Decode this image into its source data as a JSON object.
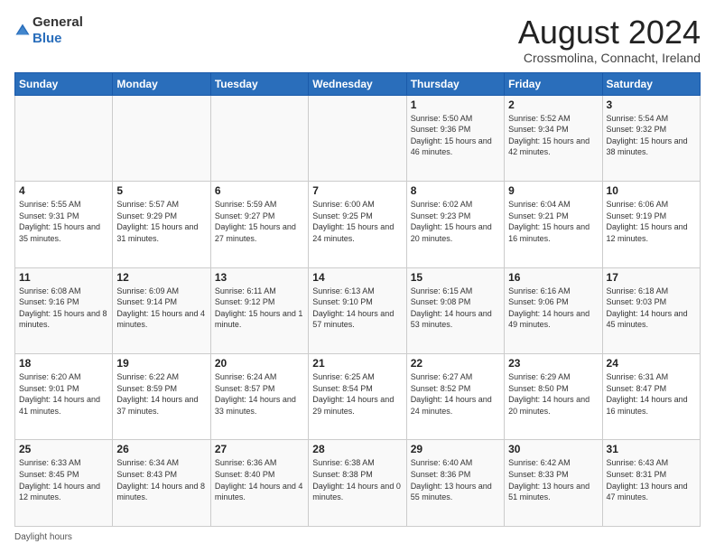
{
  "logo": {
    "general": "General",
    "blue": "Blue"
  },
  "title": "August 2024",
  "subtitle": "Crossmolina, Connacht, Ireland",
  "weekdays": [
    "Sunday",
    "Monday",
    "Tuesday",
    "Wednesday",
    "Thursday",
    "Friday",
    "Saturday"
  ],
  "footer": {
    "daylight_label": "Daylight hours"
  },
  "weeks": [
    [
      {
        "day": "",
        "sunrise": "",
        "sunset": "",
        "daylight": ""
      },
      {
        "day": "",
        "sunrise": "",
        "sunset": "",
        "daylight": ""
      },
      {
        "day": "",
        "sunrise": "",
        "sunset": "",
        "daylight": ""
      },
      {
        "day": "",
        "sunrise": "",
        "sunset": "",
        "daylight": ""
      },
      {
        "day": "1",
        "sunrise": "Sunrise: 5:50 AM",
        "sunset": "Sunset: 9:36 PM",
        "daylight": "Daylight: 15 hours and 46 minutes."
      },
      {
        "day": "2",
        "sunrise": "Sunrise: 5:52 AM",
        "sunset": "Sunset: 9:34 PM",
        "daylight": "Daylight: 15 hours and 42 minutes."
      },
      {
        "day": "3",
        "sunrise": "Sunrise: 5:54 AM",
        "sunset": "Sunset: 9:32 PM",
        "daylight": "Daylight: 15 hours and 38 minutes."
      }
    ],
    [
      {
        "day": "4",
        "sunrise": "Sunrise: 5:55 AM",
        "sunset": "Sunset: 9:31 PM",
        "daylight": "Daylight: 15 hours and 35 minutes."
      },
      {
        "day": "5",
        "sunrise": "Sunrise: 5:57 AM",
        "sunset": "Sunset: 9:29 PM",
        "daylight": "Daylight: 15 hours and 31 minutes."
      },
      {
        "day": "6",
        "sunrise": "Sunrise: 5:59 AM",
        "sunset": "Sunset: 9:27 PM",
        "daylight": "Daylight: 15 hours and 27 minutes."
      },
      {
        "day": "7",
        "sunrise": "Sunrise: 6:00 AM",
        "sunset": "Sunset: 9:25 PM",
        "daylight": "Daylight: 15 hours and 24 minutes."
      },
      {
        "day": "8",
        "sunrise": "Sunrise: 6:02 AM",
        "sunset": "Sunset: 9:23 PM",
        "daylight": "Daylight: 15 hours and 20 minutes."
      },
      {
        "day": "9",
        "sunrise": "Sunrise: 6:04 AM",
        "sunset": "Sunset: 9:21 PM",
        "daylight": "Daylight: 15 hours and 16 minutes."
      },
      {
        "day": "10",
        "sunrise": "Sunrise: 6:06 AM",
        "sunset": "Sunset: 9:19 PM",
        "daylight": "Daylight: 15 hours and 12 minutes."
      }
    ],
    [
      {
        "day": "11",
        "sunrise": "Sunrise: 6:08 AM",
        "sunset": "Sunset: 9:16 PM",
        "daylight": "Daylight: 15 hours and 8 minutes."
      },
      {
        "day": "12",
        "sunrise": "Sunrise: 6:09 AM",
        "sunset": "Sunset: 9:14 PM",
        "daylight": "Daylight: 15 hours and 4 minutes."
      },
      {
        "day": "13",
        "sunrise": "Sunrise: 6:11 AM",
        "sunset": "Sunset: 9:12 PM",
        "daylight": "Daylight: 15 hours and 1 minute."
      },
      {
        "day": "14",
        "sunrise": "Sunrise: 6:13 AM",
        "sunset": "Sunset: 9:10 PM",
        "daylight": "Daylight: 14 hours and 57 minutes."
      },
      {
        "day": "15",
        "sunrise": "Sunrise: 6:15 AM",
        "sunset": "Sunset: 9:08 PM",
        "daylight": "Daylight: 14 hours and 53 minutes."
      },
      {
        "day": "16",
        "sunrise": "Sunrise: 6:16 AM",
        "sunset": "Sunset: 9:06 PM",
        "daylight": "Daylight: 14 hours and 49 minutes."
      },
      {
        "day": "17",
        "sunrise": "Sunrise: 6:18 AM",
        "sunset": "Sunset: 9:03 PM",
        "daylight": "Daylight: 14 hours and 45 minutes."
      }
    ],
    [
      {
        "day": "18",
        "sunrise": "Sunrise: 6:20 AM",
        "sunset": "Sunset: 9:01 PM",
        "daylight": "Daylight: 14 hours and 41 minutes."
      },
      {
        "day": "19",
        "sunrise": "Sunrise: 6:22 AM",
        "sunset": "Sunset: 8:59 PM",
        "daylight": "Daylight: 14 hours and 37 minutes."
      },
      {
        "day": "20",
        "sunrise": "Sunrise: 6:24 AM",
        "sunset": "Sunset: 8:57 PM",
        "daylight": "Daylight: 14 hours and 33 minutes."
      },
      {
        "day": "21",
        "sunrise": "Sunrise: 6:25 AM",
        "sunset": "Sunset: 8:54 PM",
        "daylight": "Daylight: 14 hours and 29 minutes."
      },
      {
        "day": "22",
        "sunrise": "Sunrise: 6:27 AM",
        "sunset": "Sunset: 8:52 PM",
        "daylight": "Daylight: 14 hours and 24 minutes."
      },
      {
        "day": "23",
        "sunrise": "Sunrise: 6:29 AM",
        "sunset": "Sunset: 8:50 PM",
        "daylight": "Daylight: 14 hours and 20 minutes."
      },
      {
        "day": "24",
        "sunrise": "Sunrise: 6:31 AM",
        "sunset": "Sunset: 8:47 PM",
        "daylight": "Daylight: 14 hours and 16 minutes."
      }
    ],
    [
      {
        "day": "25",
        "sunrise": "Sunrise: 6:33 AM",
        "sunset": "Sunset: 8:45 PM",
        "daylight": "Daylight: 14 hours and 12 minutes."
      },
      {
        "day": "26",
        "sunrise": "Sunrise: 6:34 AM",
        "sunset": "Sunset: 8:43 PM",
        "daylight": "Daylight: 14 hours and 8 minutes."
      },
      {
        "day": "27",
        "sunrise": "Sunrise: 6:36 AM",
        "sunset": "Sunset: 8:40 PM",
        "daylight": "Daylight: 14 hours and 4 minutes."
      },
      {
        "day": "28",
        "sunrise": "Sunrise: 6:38 AM",
        "sunset": "Sunset: 8:38 PM",
        "daylight": "Daylight: 14 hours and 0 minutes."
      },
      {
        "day": "29",
        "sunrise": "Sunrise: 6:40 AM",
        "sunset": "Sunset: 8:36 PM",
        "daylight": "Daylight: 13 hours and 55 minutes."
      },
      {
        "day": "30",
        "sunrise": "Sunrise: 6:42 AM",
        "sunset": "Sunset: 8:33 PM",
        "daylight": "Daylight: 13 hours and 51 minutes."
      },
      {
        "day": "31",
        "sunrise": "Sunrise: 6:43 AM",
        "sunset": "Sunset: 8:31 PM",
        "daylight": "Daylight: 13 hours and 47 minutes."
      }
    ]
  ]
}
